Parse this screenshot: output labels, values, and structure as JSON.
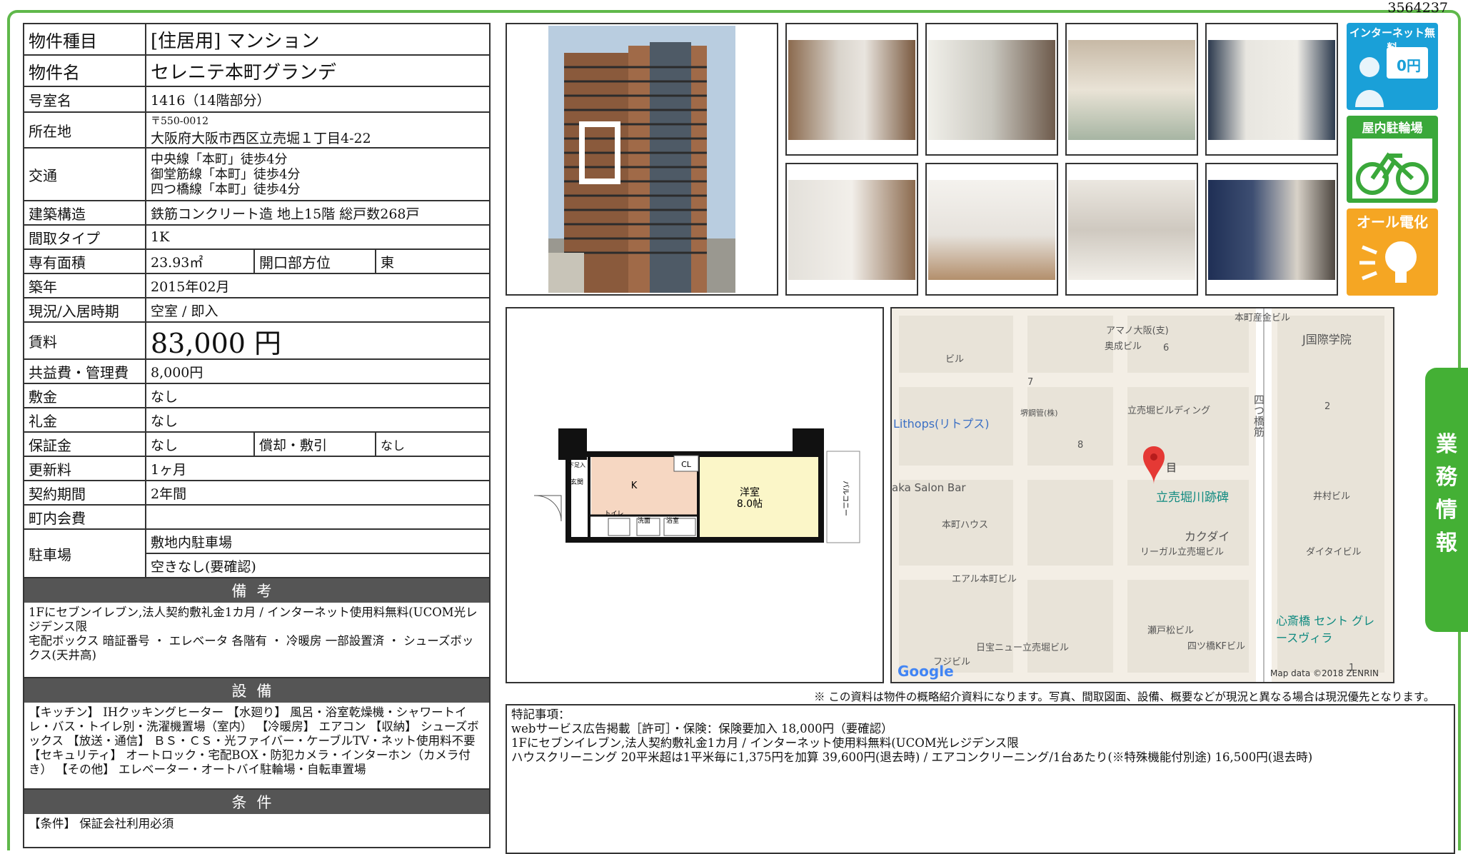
{
  "doc_id": "3564237",
  "property": {
    "type_label": "物件種目",
    "type_value": "[住居用] マンション",
    "name_label": "物件名",
    "name_value": "セレニテ本町グランデ",
    "room_label": "号室名",
    "room_value": "1416（14階部分）",
    "address_label": "所在地",
    "postal": "〒550-0012",
    "address": "大阪府大阪市西区立売堀１丁目4-22",
    "transit_label": "交通",
    "transit_1": "中央線「本町」徒歩4分",
    "transit_2": "御堂筋線「本町」徒歩4分",
    "transit_3": "四つ橋線「本町」徒歩4分",
    "structure_label": "建築構造",
    "structure_value": "鉄筋コンクリート造 地上15階 総戸数268戸",
    "layout_label": "間取タイプ",
    "layout_value": "1K",
    "area_label": "専有面積",
    "area_value": "23.93㎡",
    "direction_label": "開口部方位",
    "direction_value": "東",
    "built_label": "築年",
    "built_value": "2015年02月",
    "status_label": "現況/入居時期",
    "status_value": "空室 / 即入",
    "rent_label": "賃料",
    "rent_value": "83,000 円",
    "fee_label": "共益費・管理費",
    "fee_value": "8,000円",
    "deposit_label": "敷金",
    "deposit_value": "なし",
    "keymoney_label": "礼金",
    "keymoney_value": "なし",
    "guarantee_label": "保証金",
    "guarantee_value": "なし",
    "amort_label": "償却・敷引",
    "amort_value": "なし",
    "renewal_label": "更新料",
    "renewal_value": "1ヶ月",
    "contract_label": "契約期間",
    "contract_value": "2年間",
    "assoc_label": "町内会費",
    "assoc_value": "",
    "parking_label": "駐車場",
    "parking_value_1": "敷地内駐車場",
    "parking_value_2": "空きなし(要確認)"
  },
  "remarks": {
    "title": "備考",
    "line_1": "1Fにセブンイレブン,法人契約敷礼金1カ月 / インターネット使用料無料(UCOM光レジデンス限",
    "line_2": "宅配ボックス 暗証番号 ・ エレベータ 各階有 ・ 冷暖房 一部設置済 ・ シューズボックス(天井高)"
  },
  "equipment": {
    "title": "設備",
    "text": "【キッチン】 IHクッキングヒーター 【水廻り】 風呂・浴室乾燥機・シャワートイレ・バス・トイレ別・洗濯機置場（室内） 【冷暖房】 エアコン 【収納】 シューズボックス 【放送・通信】 ＢＳ・ＣＳ・光ファイバー・ケーブルTV・ネット使用料不要 【セキュリティ】 オートロック・宅配BOX・防犯カメラ・インターホン（カメラ付き） 【その他】 エレベーター・オートバイ駐輪場・自転車置場"
  },
  "conditions": {
    "title": "条件",
    "text": "【条件】 保証会社利用必須"
  },
  "badges": {
    "internet": "インターネット無料",
    "internet_price": "0円",
    "bike": "屋内駐輪場",
    "electric": "オール電化"
  },
  "floorplan": {
    "room": "洋室",
    "room_size": "8.0帖",
    "kitchen": "K",
    "closet": "CL",
    "entrance": "玄関",
    "toilet": "トイレ",
    "wash": "洗面",
    "bath": "浴室",
    "balcony": "バルコニー",
    "shoebox": "下足入"
  },
  "map": {
    "labels": [
      "本町産金ビル",
      "アマノ大阪(支)",
      "奥成ビル",
      "J国際学院",
      "ビル",
      "Lithops(リトプス)",
      "堺鋼管(株)",
      "立売堀ビルディング",
      "aka Salon Bar",
      "本町ハウス",
      "立売堀川跡碑",
      "カクダイ",
      "リーガル立売堀ビル",
      "井村ビル",
      "ダイタイビル",
      "エアル本町ビル",
      "瀬戸松ビル",
      "四ツ橋KFビル",
      "心斎橋 セント グレースヴィラ",
      "日宝ニュー立売堀ビル",
      "フジビル",
      "四つ橋筋",
      "目"
    ],
    "numbers": [
      "6",
      "7",
      "8",
      "2",
      "1"
    ],
    "google": "Google",
    "attribution": "Map data ©2018 ZENRIN"
  },
  "disclaimer": "※ この資料は物件の概略紹介資料になります。写真、間取図面、設備、概要などが現況と異なる場合は現況優先となります。",
  "special": {
    "title": "特記事項：",
    "line_1": "webサービス広告掲載［許可］・保険：保険要加入 18,000円（要確認）",
    "line_2": "1Fにセブンイレブン,法人契約敷礼金1カ月 / インターネット使用料無料(UCOM光レジデンス限",
    "line_3": "ハウスクリーニング 20平米超は1平米毎に1,375円を加算 39,600円(退去時) / エアコンクリーニング/1台あたり(※特殊機能付別途) 16,500円(退去時)"
  },
  "side_tab": [
    "業",
    "務",
    "情",
    "報"
  ],
  "colors": {
    "accent_green": "#44b035",
    "badge_blue": "#1aa0d8",
    "badge_green": "#3aa83a",
    "badge_orange": "#f5a623"
  }
}
